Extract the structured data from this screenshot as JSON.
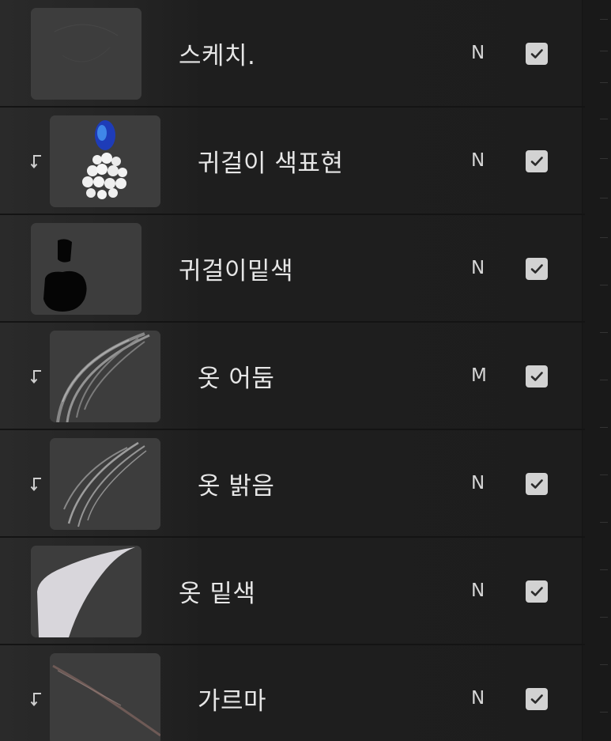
{
  "layers": [
    {
      "name": "스케치.",
      "blend": "N",
      "visible": true,
      "clipped": false,
      "thumbnail": "sketch-thumbnail"
    },
    {
      "name": "귀걸이 색표현",
      "blend": "N",
      "visible": true,
      "clipped": true,
      "thumbnail": "earring-color-thumbnail"
    },
    {
      "name": "귀걸이밑색",
      "blend": "N",
      "visible": true,
      "clipped": false,
      "thumbnail": "earring-base-thumbnail"
    },
    {
      "name": "옷 어둠",
      "blend": "M",
      "visible": true,
      "clipped": true,
      "thumbnail": "clothes-shadow-thumbnail"
    },
    {
      "name": "옷 밝음",
      "blend": "N",
      "visible": true,
      "clipped": true,
      "thumbnail": "clothes-light-thumbnail"
    },
    {
      "name": "옷 밑색",
      "blend": "N",
      "visible": true,
      "clipped": false,
      "thumbnail": "clothes-base-thumbnail"
    },
    {
      "name": "가르마",
      "blend": "N",
      "visible": true,
      "clipped": true,
      "thumbnail": "hair-part-thumbnail"
    }
  ],
  "colors": {
    "panel_bg": "#1e1e1e",
    "thumb_bg": "#3c3c3c",
    "checkbox": "#d2d2d2",
    "text": "#e6e6e6"
  }
}
